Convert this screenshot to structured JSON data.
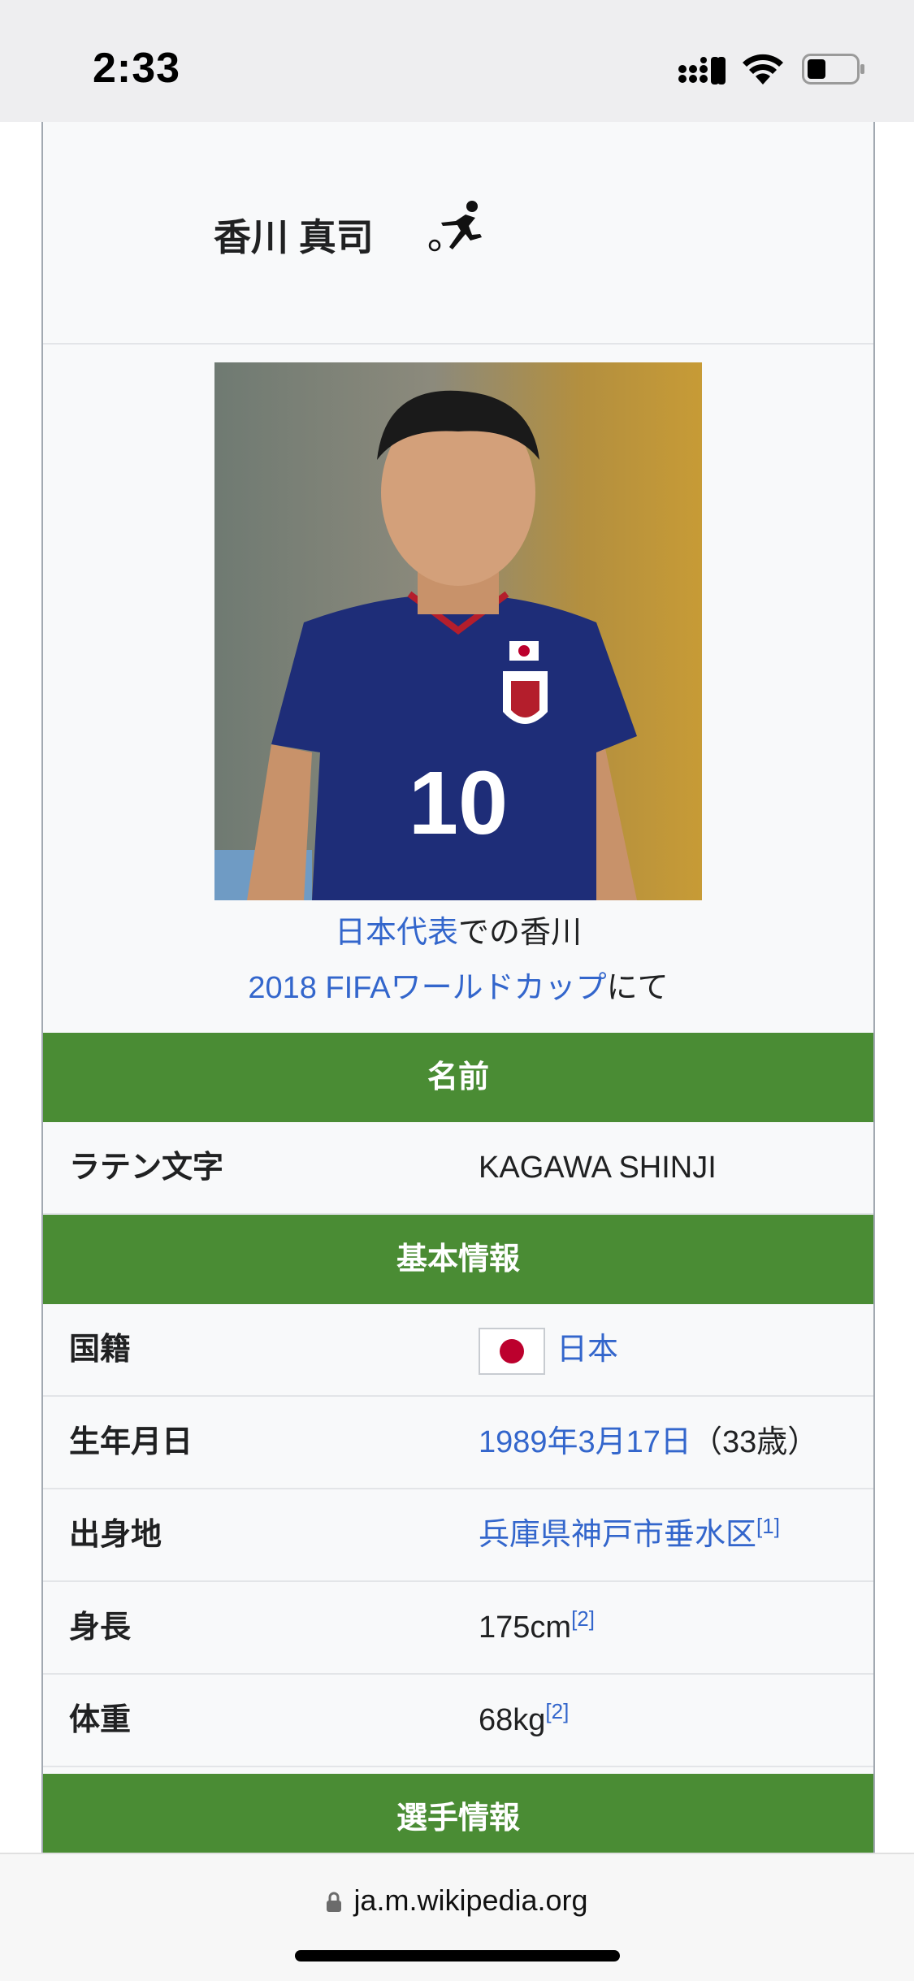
{
  "status_bar": {
    "time": "2:33"
  },
  "infobox": {
    "title": "香川 真司",
    "caption": {
      "line1_link": "日本代表",
      "line1_text": "での香川",
      "line2_link": "2018 FIFAワールドカップ",
      "line2_text": "にて"
    },
    "sections": {
      "name": "名前",
      "basic_info": "基本情報",
      "player_info": "選手情報"
    },
    "rows": {
      "latin": {
        "label": "ラテン文字",
        "value": "KAGAWA SHINJI"
      },
      "nationality": {
        "label": "国籍",
        "value": "日本"
      },
      "birth": {
        "label": "生年月日",
        "date": "1989年3月17日",
        "age": "（33歳）"
      },
      "birthplace": {
        "label": "出身地",
        "value": "兵庫県神戸市垂水区",
        "ref": "[1]"
      },
      "height": {
        "label": "身長",
        "value": "175cm",
        "ref": "[2]"
      },
      "weight": {
        "label": "体重",
        "value": "68kg",
        "ref": "[2]"
      }
    },
    "colors": {
      "section_header": "#4a8c34",
      "link": "#3366cc"
    }
  },
  "browser": {
    "url": "ja.m.wikipedia.org"
  }
}
